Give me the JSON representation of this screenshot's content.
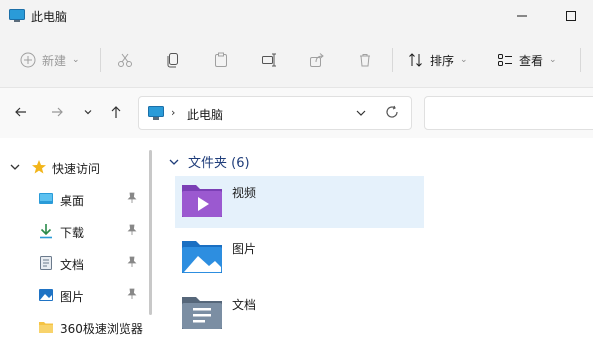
{
  "window": {
    "title": "此电脑",
    "app_icon": "this-pc-icon"
  },
  "toolbar": {
    "new_label": "新建",
    "sort_label": "排序",
    "view_label": "查看",
    "icons": [
      "new-icon",
      "cut-icon",
      "copy-icon",
      "paste-icon",
      "rename-icon",
      "share-icon",
      "delete-icon",
      "sort-icon",
      "view-icon"
    ]
  },
  "address": {
    "path": "此电脑",
    "separator": "›"
  },
  "sidebar": {
    "quick_access": "快速访问",
    "items": [
      {
        "label": "桌面",
        "icon": "desktop-icon",
        "pinned": true
      },
      {
        "label": "下载",
        "icon": "download-icon",
        "pinned": true
      },
      {
        "label": "文档",
        "icon": "documents-icon",
        "pinned": true
      },
      {
        "label": "图片",
        "icon": "pictures-icon",
        "pinned": true
      },
      {
        "label": "360极速浏览器",
        "icon": "folder-icon",
        "pinned": false
      }
    ]
  },
  "content": {
    "group_title": "文件夹 (6)",
    "folders": [
      {
        "label": "视频",
        "icon": "videos-folder-icon",
        "selected": true
      },
      {
        "label": "图片",
        "icon": "pictures-folder-icon",
        "selected": false
      },
      {
        "label": "文档",
        "icon": "documents-folder-icon",
        "selected": false
      }
    ]
  },
  "colors": {
    "accent": "#0067c0",
    "selection": "#e5f1fb",
    "group_header": "#1f3d7a"
  }
}
